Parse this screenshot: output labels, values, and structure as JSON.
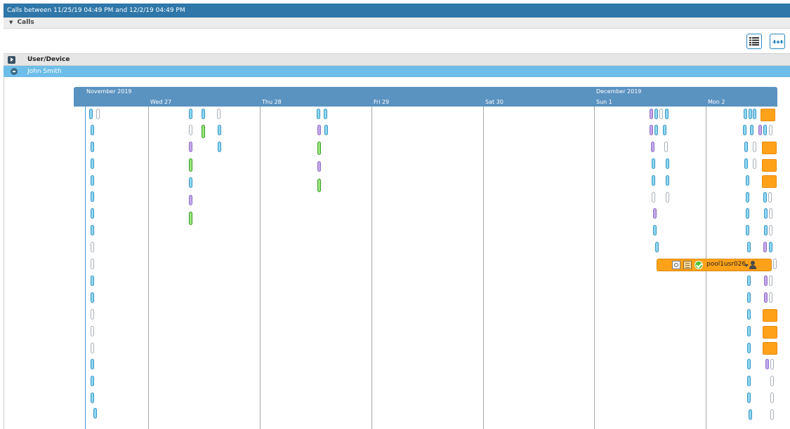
{
  "header": {
    "title": "Calls between 11/25/19 04:49 PM and 12/2/19 04:49 PM"
  },
  "calls_panel": {
    "label": "Calls"
  },
  "toolbar": {
    "list_view_icon": "list-icon",
    "timeline_view_icon": "timeline-icon"
  },
  "table": {
    "column_header": "User/Device",
    "user_row": "John Smith"
  },
  "timeline": {
    "months": [
      "November 2019",
      "December 2019"
    ],
    "days": [
      "Wed 27",
      "Thu 28",
      "Fri 29",
      "Sat 30",
      "Sun 1",
      "Mon 2"
    ]
  },
  "popup": {
    "username": "pool1usr026"
  }
}
